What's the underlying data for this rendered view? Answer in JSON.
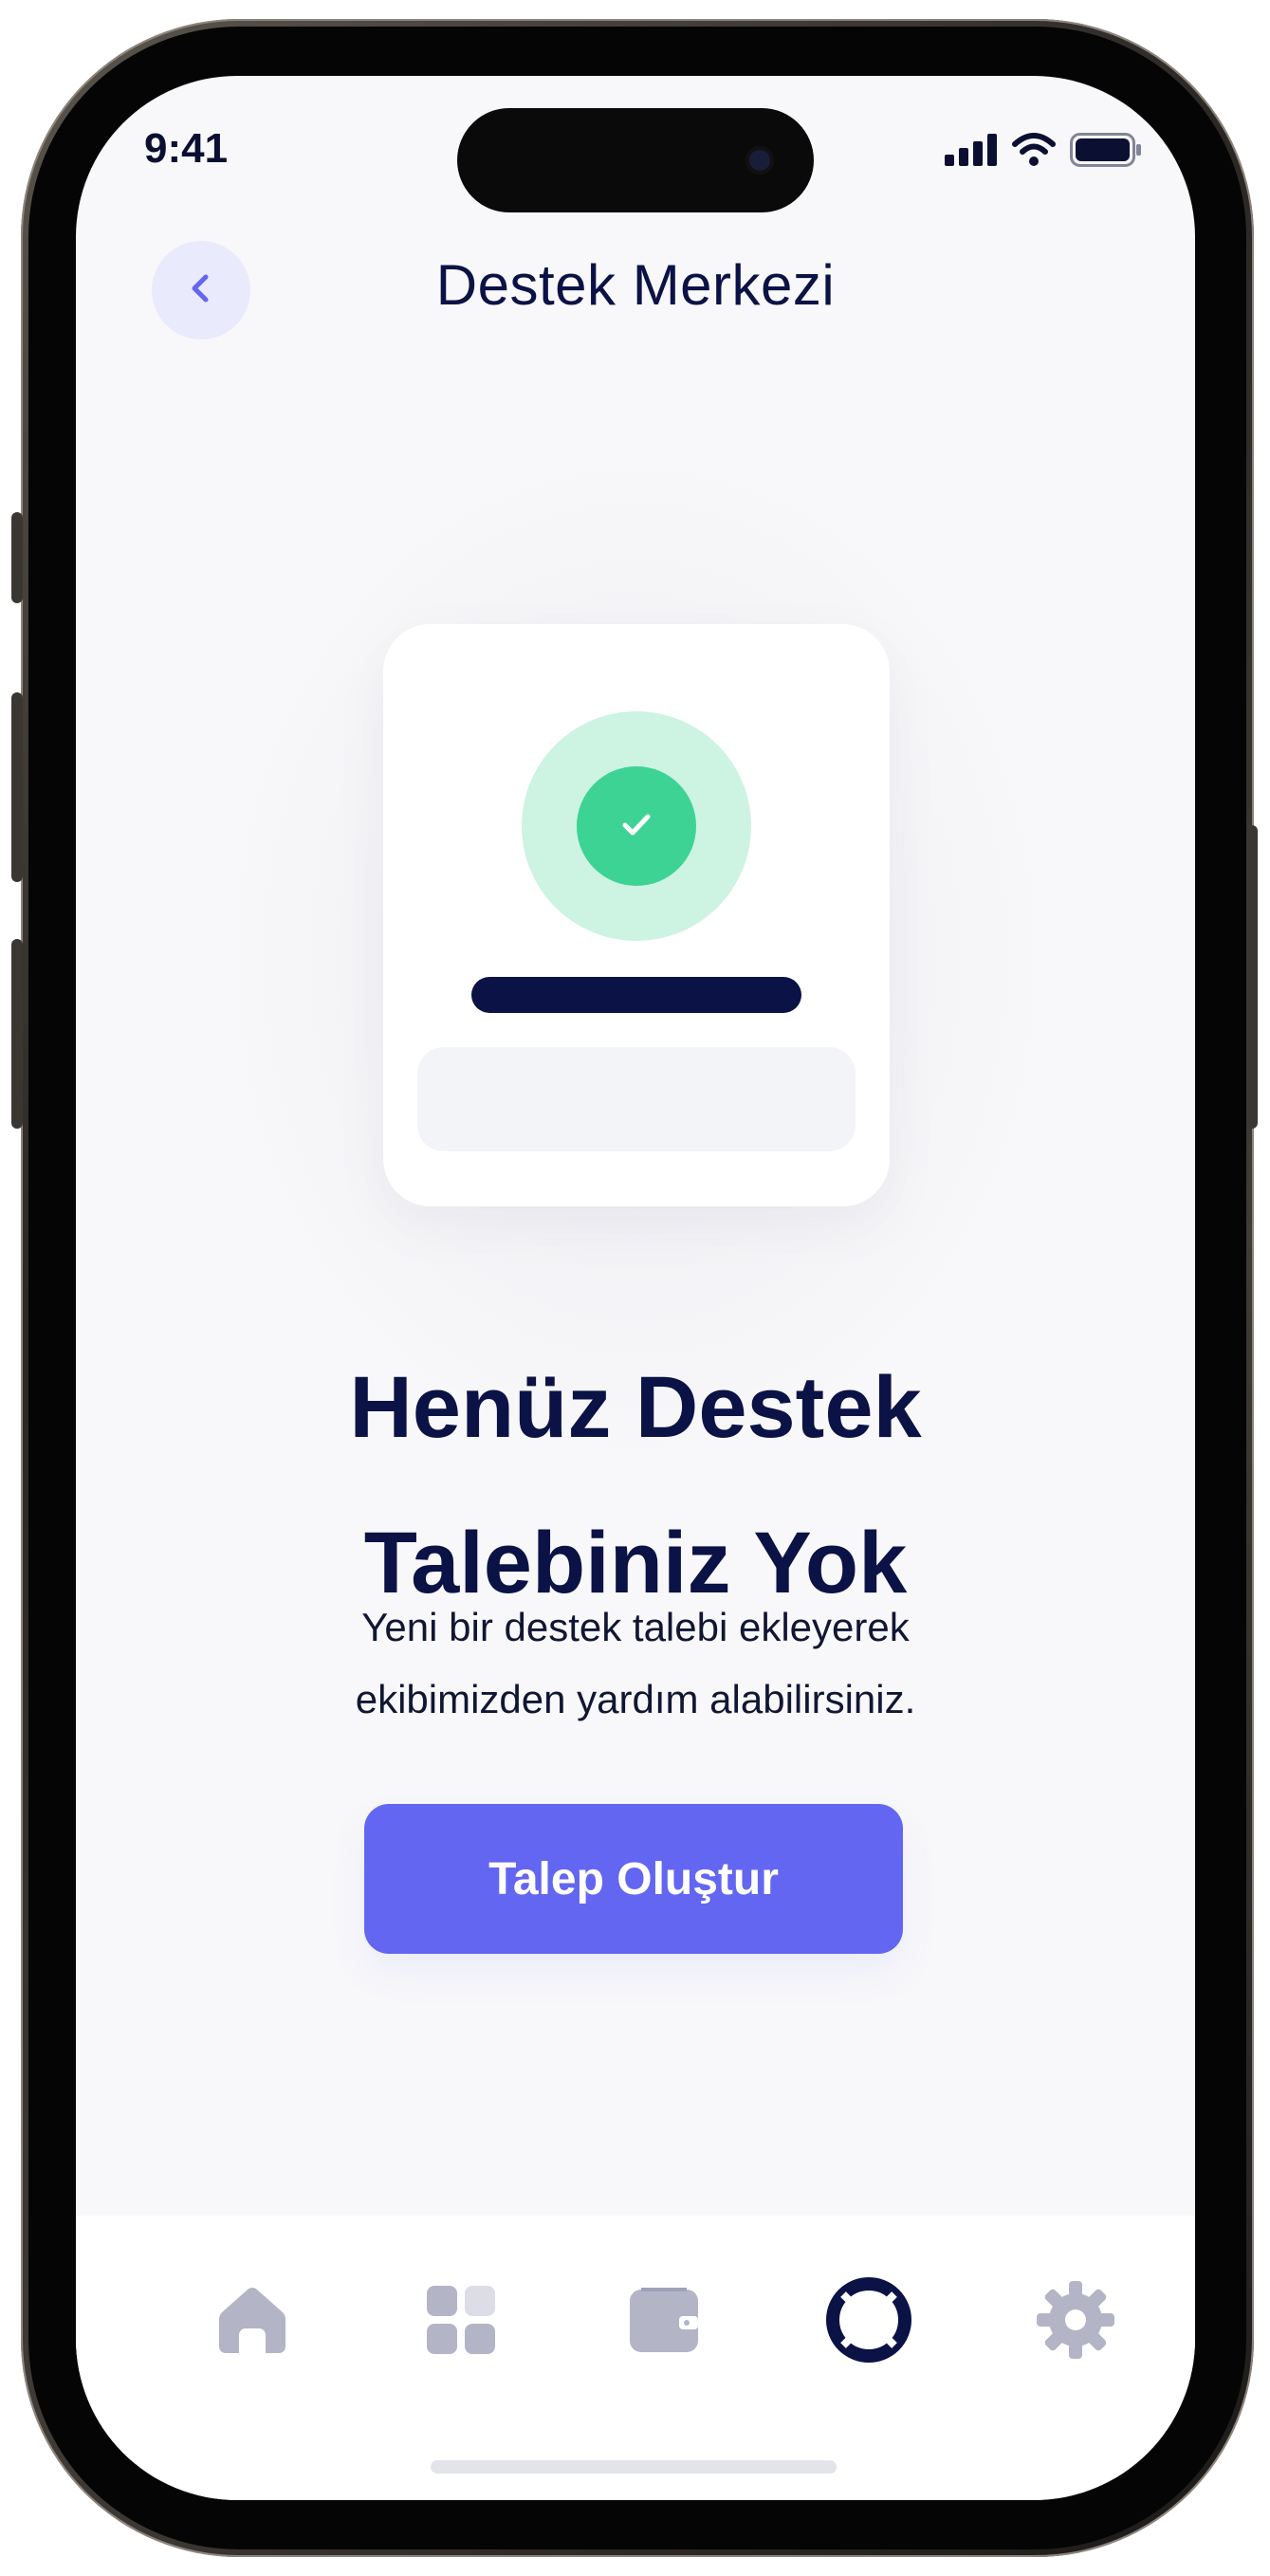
{
  "status_bar": {
    "time": "9:41",
    "icons": [
      "signal-icon",
      "wifi-icon",
      "battery-icon"
    ]
  },
  "header": {
    "back_icon": "chevron-left-icon",
    "title": "Destek Merkezi"
  },
  "illustration": {
    "icon": "check-icon"
  },
  "empty_state": {
    "title_line1": "Henüz Destek",
    "title_line2": "Talebiniz Yok",
    "subtitle_line1": "Yeni bir destek talebi ekleyerek",
    "subtitle_line2": "ekibimizden yardım alabilirsiniz."
  },
  "cta": {
    "label": "Talep Oluştur"
  },
  "tab_bar": {
    "items": [
      {
        "icon": "home-icon",
        "active": false
      },
      {
        "icon": "grid-icon",
        "active": false
      },
      {
        "icon": "wallet-icon",
        "active": false
      },
      {
        "icon": "lifebuoy-icon",
        "active": true
      },
      {
        "icon": "gear-icon",
        "active": false
      }
    ]
  },
  "colors": {
    "primary": "#6366f1",
    "navy": "#0b1245",
    "success": "#3dd394",
    "success_light": "#cdf3e2",
    "inactive_icon": "#b3b5c6"
  }
}
